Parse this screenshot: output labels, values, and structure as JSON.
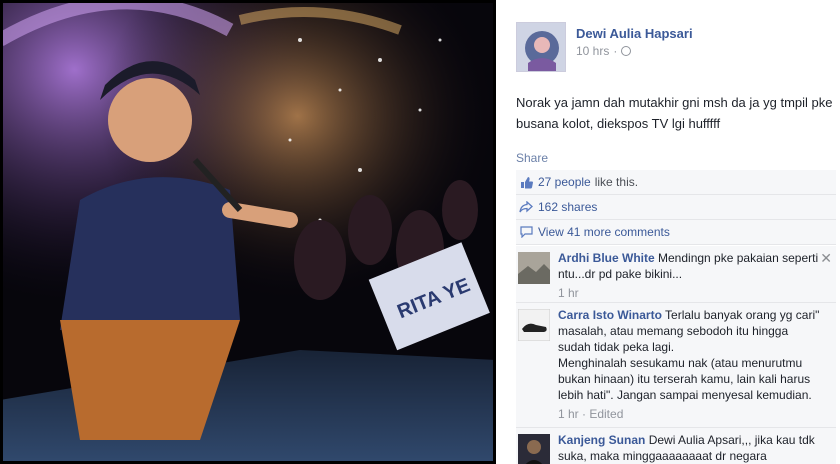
{
  "post": {
    "author": "Dewi Aulia Hapsari",
    "time": "10 hrs",
    "separator": "·",
    "text": "Norak ya jamn dah mutakhir gni msh da ja yg tmpil pke busana kolot, diekspos TV lgi hufffff"
  },
  "actions": {
    "share": "Share"
  },
  "ufi": {
    "likes_link": "27 people",
    "likes_suffix": "like this.",
    "shares": "162 shares",
    "view_comments": "View 41 more comments"
  },
  "comments": [
    {
      "name": "Ardhi Blue White",
      "text": "Mendingn pke pakaian seperti ntu...dr pd pake bikini...",
      "time": "1 hr"
    },
    {
      "name": "Carra Isto Winarto",
      "text": "Terlalu banyak orang yg cari\" masalah, atau memang sebodoh itu hingga sudah tidak peka lagi.",
      "text2": "Menghinalah sesukamu nak (atau menurutmu bukan hinaan) itu terserah kamu, lain kali harus lebih hati\". Jangan sampai menyesal kemudian.",
      "time": "1 hr · Edited"
    },
    {
      "name": "Kanjeng Sunan",
      "text": "Dewi Aulia Apsari,,, jika kau tdk suka, maka minggaaaaaaaat dr negara"
    }
  ],
  "photo": {
    "banner_text": "RITA YE"
  },
  "icons": {
    "like": "thumbs-up-icon",
    "share": "share-arrow-icon",
    "comment": "comment-bubble-icon",
    "privacy": "globe-icon",
    "close": "close-icon"
  },
  "colors": {
    "link": "#3b5998",
    "ufi_bg": "#f6f7f9",
    "muted": "#90949c"
  }
}
